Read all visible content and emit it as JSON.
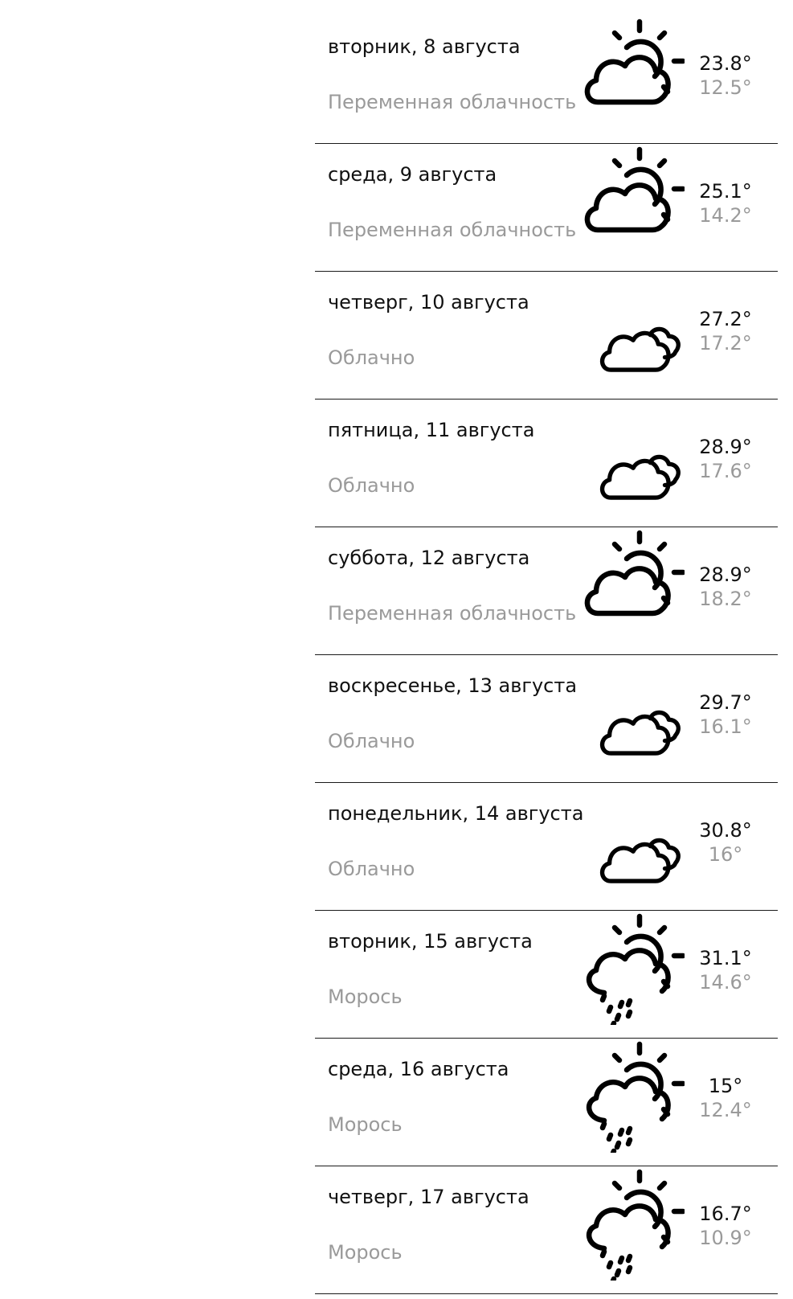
{
  "forecast": [
    {
      "date": "вторник, 8 августа",
      "condition": "Переменная облачность",
      "icon": "partly-cloudy",
      "max": "23.8°",
      "min": "12.5°"
    },
    {
      "date": "среда, 9 августа",
      "condition": "Переменная облачность",
      "icon": "partly-cloudy",
      "max": "25.1°",
      "min": "14.2°"
    },
    {
      "date": "четверг, 10 августа",
      "condition": "Облачно",
      "icon": "cloudy",
      "max": "27.2°",
      "min": "17.2°"
    },
    {
      "date": "пятница, 11 августа",
      "condition": "Облачно",
      "icon": "cloudy",
      "max": "28.9°",
      "min": "17.6°"
    },
    {
      "date": "суббота, 12 августа",
      "condition": "Переменная облачность",
      "icon": "partly-cloudy",
      "max": "28.9°",
      "min": "18.2°"
    },
    {
      "date": "воскресенье, 13 августа",
      "condition": "Облачно",
      "icon": "cloudy",
      "max": "29.7°",
      "min": "16.1°"
    },
    {
      "date": "понедельник, 14 августа",
      "condition": "Облачно",
      "icon": "cloudy",
      "max": "30.8°",
      "min": "16°"
    },
    {
      "date": "вторник, 15 августа",
      "condition": "Морось",
      "icon": "drizzle",
      "max": "31.1°",
      "min": "14.6°"
    },
    {
      "date": "среда, 16 августа",
      "condition": "Морось",
      "icon": "drizzle",
      "max": "15°",
      "min": "12.4°"
    },
    {
      "date": "четверг, 17 августа",
      "condition": "Морось",
      "icon": "drizzle",
      "max": "16.7°",
      "min": "10.9°"
    }
  ]
}
